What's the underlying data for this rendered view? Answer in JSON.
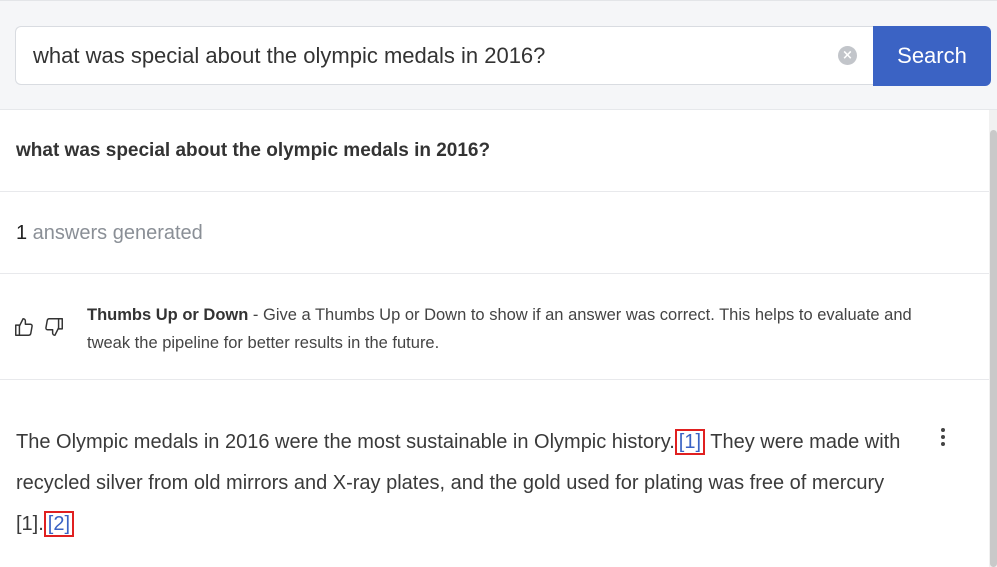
{
  "search": {
    "query": "what was special about the olympic medals in 2016?",
    "clear_icon": "×",
    "button_label": "Search"
  },
  "results": {
    "question": "what was special about the olympic medals in 2016?",
    "count": "1",
    "count_label": " answers generated"
  },
  "feedback": {
    "title": "Thumbs Up or Down",
    "description": " - Give a Thumbs Up or Down to show if an answer was correct. This helps to evaluate and tweak the pipeline for better results in the future.",
    "icons": [
      "thumbs-up-icon",
      "thumbs-down-icon"
    ]
  },
  "answer": {
    "part1": "The Olympic medals in 2016 were the most sustainable in Olympic history.",
    "cite1": "[1]",
    "part2": " They were made with recycled silver from old mirrors and X-ray plates, and the gold used for plating was free of mercury [1].",
    "cite2": "[2]",
    "menu_icon": "more-vertical-icon"
  },
  "colors": {
    "accent": "#3b63c4",
    "highlight_box": "#e02020"
  }
}
